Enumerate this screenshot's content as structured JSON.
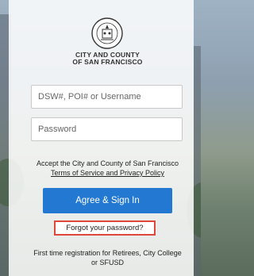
{
  "org": {
    "line1": "CITY AND COUNTY",
    "line2": "OF SAN FRANCISCO"
  },
  "form": {
    "username_placeholder": "DSW#, POI# or Username",
    "username_value": "",
    "password_placeholder": "Password",
    "password_value": ""
  },
  "terms": {
    "accept_text": "Accept the City and County of San Francisco",
    "link_text": "Terms of Service and Privacy Policy"
  },
  "actions": {
    "sign_in_label": "Agree & Sign In",
    "forgot_label": "Forgot your password?",
    "first_time_line1": "First time registration for Retirees, City College",
    "first_time_line2": "or SFUSD"
  },
  "colors": {
    "primary_button": "#2379d1",
    "highlight_border": "#e0463c"
  },
  "icons": {
    "seal": "city-seal-icon"
  }
}
